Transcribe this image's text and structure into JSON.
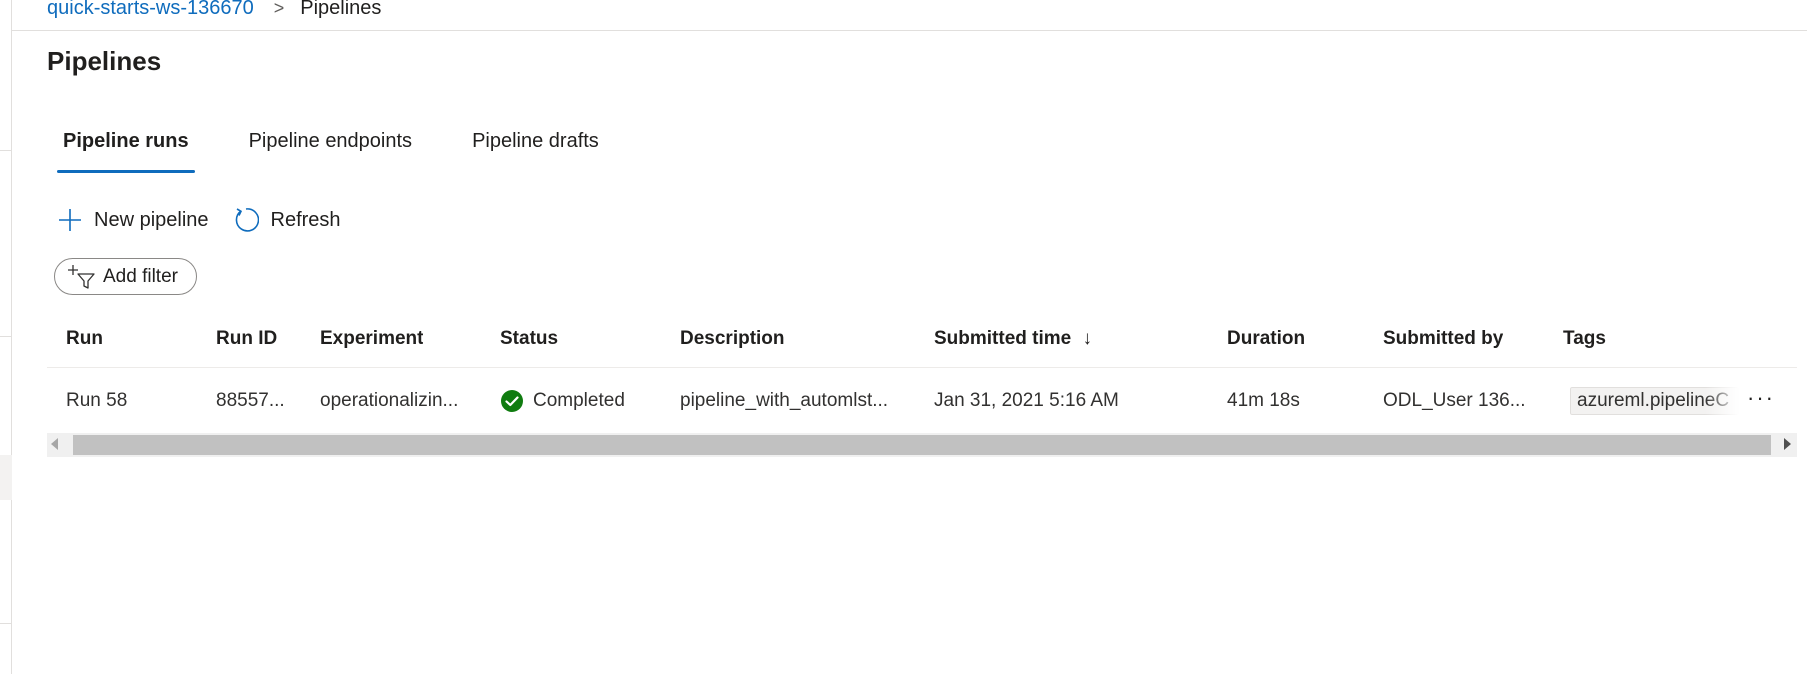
{
  "breadcrumb": {
    "workspace": "quick-starts-ws-136670",
    "separator": ">",
    "current": "Pipelines"
  },
  "page": {
    "title": "Pipelines"
  },
  "tabs": [
    {
      "label": "Pipeline runs",
      "active": true
    },
    {
      "label": "Pipeline endpoints",
      "active": false
    },
    {
      "label": "Pipeline drafts",
      "active": false
    }
  ],
  "toolbar": {
    "new_pipeline": {
      "label": "New pipeline",
      "icon": "plus-icon"
    },
    "refresh": {
      "label": "Refresh",
      "icon": "refresh-icon"
    }
  },
  "filter": {
    "label": "Add filter",
    "icon": "add-filter-icon"
  },
  "table": {
    "columns": [
      "Run",
      "Run ID",
      "Experiment",
      "Status",
      "Description",
      "Submitted time",
      "Duration",
      "Submitted by",
      "Tags"
    ],
    "sort_indicator": "↓",
    "rows": [
      {
        "run": "Run 58",
        "run_id": "88557...",
        "experiment": "operationalizin...",
        "status": "Completed",
        "status_icon": "check-circle-icon",
        "description": "pipeline_with_automlst...",
        "submitted_time": "Jan 31, 2021 5:16 AM",
        "duration": "41m 18s",
        "submitted_by": "ODL_User 136...",
        "tag": "azureml.pipelineC"
      }
    ]
  },
  "colors": {
    "accent": "#0f6cbd",
    "success": "#107c10",
    "text": "#201f1e",
    "border": "#e1dfdd"
  }
}
